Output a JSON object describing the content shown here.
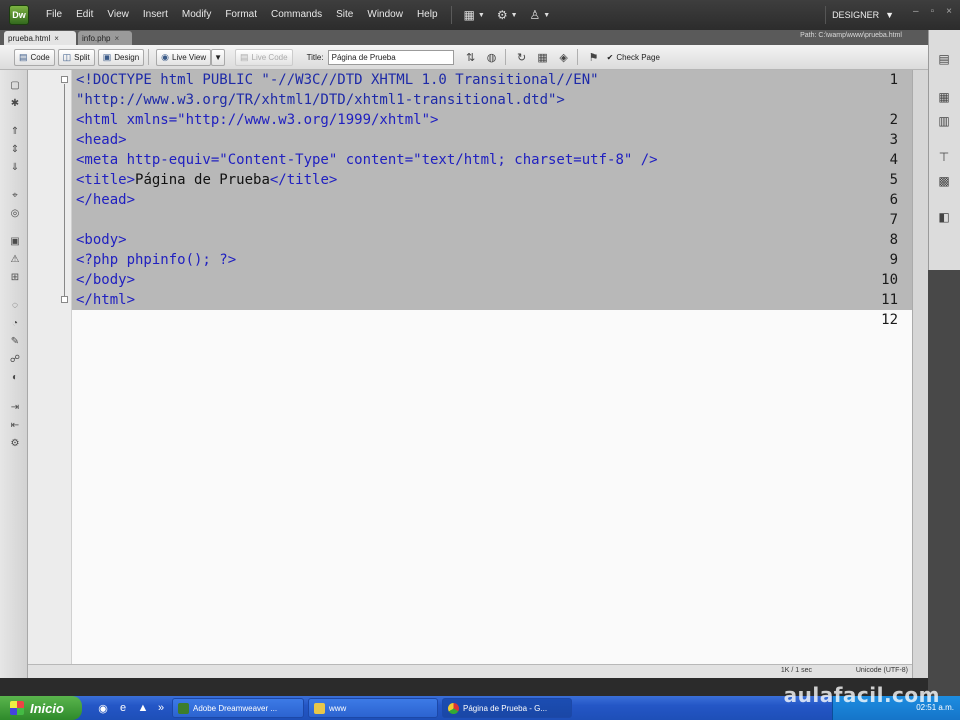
{
  "app": {
    "logo": "Dw",
    "menu": [
      "File",
      "Edit",
      "View",
      "Insert",
      "Modify",
      "Format",
      "Commands",
      "Site",
      "Window",
      "Help"
    ],
    "workspace": "DESIGNER",
    "window_controls": [
      "–",
      "▫",
      "×"
    ]
  },
  "tabs": [
    {
      "label": "prueba.html",
      "close": "×"
    },
    {
      "label": "info.php",
      "close": "×"
    }
  ],
  "path": "Path:  C:\\wamp\\www\\prueba.html",
  "toolbar": {
    "code": "Code",
    "split": "Split",
    "design": "Design",
    "live_view": "Live View",
    "live_code": "Live Code",
    "title_label": "Title:",
    "title_value": "Página de Prueba",
    "check_page": "Check Page"
  },
  "editor": {
    "lines": [
      {
        "num": "1",
        "text": "<!DOCTYPE html PUBLIC \"-//W3C//DTD XHTML 1.0 Transitional//EN\""
      },
      {
        "num": "",
        "text": "\"http://www.w3.org/TR/xhtml1/DTD/xhtml1-transitional.dtd\">"
      },
      {
        "num": "2",
        "text": "<html xmlns=\"http://www.w3.org/1999/xhtml\">"
      },
      {
        "num": "3",
        "text": "<head>"
      },
      {
        "num": "4",
        "text": "<meta http-equiv=\"Content-Type\" content=\"text/html; charset=utf-8\" />"
      },
      {
        "num": "5",
        "text": "<title>",
        "plain": "Página de Prueba",
        "after": "</title>"
      },
      {
        "num": "6",
        "text": "</head>"
      },
      {
        "num": "7",
        "text": ""
      },
      {
        "num": "8",
        "text": "<body>"
      },
      {
        "num": "9",
        "text": "<?php phpinfo(); ?>"
      },
      {
        "num": "10",
        "text": "</body>"
      },
      {
        "num": "11",
        "text": "</html>"
      },
      {
        "num": "12",
        "text": ""
      }
    ]
  },
  "status": {
    "time": "1K / 1 sec",
    "encoding": "Unicode (UTF-8)"
  },
  "taskbar": {
    "start": "Inicio",
    "items": [
      "Adobe Dreamweaver ...",
      "www",
      "Página de Prueba - G..."
    ],
    "clock": "02:51 a.m."
  },
  "watermark": "aulafacil.com",
  "colors": {
    "tag": "#2020c0",
    "selection": "#b8b8b8",
    "taskbar": "#2456c6",
    "start": "#2e8a2b"
  }
}
